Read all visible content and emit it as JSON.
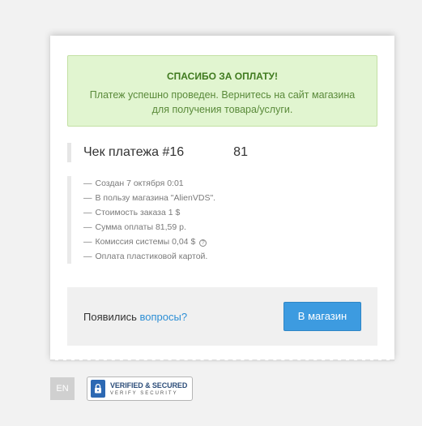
{
  "success": {
    "title": "СПАСИБО ЗА ОПЛАТУ!",
    "message": "Платеж успешно проведен. Вернитесь на сайт магазина для получения товара/услуги."
  },
  "receipt": {
    "title": "Чек платежа #16",
    "amount": "81"
  },
  "details": [
    {
      "dash": "—",
      "text": "Создан 7 октября 0:01"
    },
    {
      "dash": "—",
      "text": "В пользу магазина \"AlienVDS\"."
    },
    {
      "dash": "—",
      "text": "Стоимость заказа 1 $"
    },
    {
      "dash": "—",
      "text": "Сумма оплаты 81,59 р."
    },
    {
      "dash": "—",
      "text": "Комиссия системы 0,04 $",
      "help": "?"
    },
    {
      "dash": "—",
      "text": "Оплата пластиковой картой."
    }
  ],
  "footer": {
    "question_prefix": "Появились ",
    "question_link": "вопросы?",
    "store_button": "В магазин"
  },
  "language": "EN",
  "badge": {
    "main": "VERIFIED & SECURED",
    "sub": "VERIFY SECURITY",
    "icon": "lock-shield-icon"
  },
  "colors": {
    "success_bg": "#e1f5d0",
    "success_title": "#3f7a1e",
    "button_bg": "#3d9be0",
    "link": "#2d8fd5"
  }
}
